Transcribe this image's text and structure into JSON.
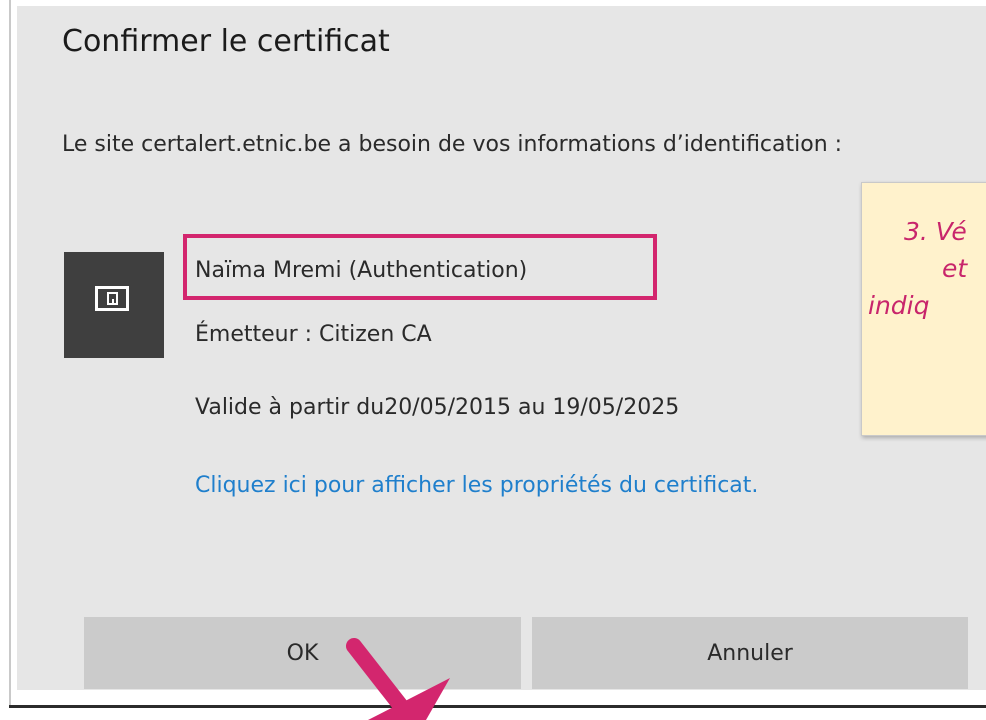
{
  "dialog": {
    "title": "Confirmer le certificat",
    "message": "Le site certalert.etnic.be a besoin de vos informations d’identification :",
    "certificate": {
      "icon": "certificate-card-icon",
      "name": "Naïma Mremi (Authentication)",
      "issuer": "Émetteur : Citizen CA",
      "validity": "Valide à partir du20/05/2015 au 19/05/2025"
    },
    "properties_link": "Cliquez ici pour afficher les propriétés du certificat.",
    "buttons": {
      "ok": "OK",
      "cancel": "Annuler"
    }
  },
  "annotation": {
    "callout_lines": [
      "3. Vé",
      "et",
      "indiq"
    ],
    "highlight_color": "#d3266e",
    "arrow_icon": "pointer-arrow-icon"
  },
  "colors": {
    "dialog_bg": "#e6e6e6",
    "button_bg": "#cbcbcb",
    "link": "#1f7fcc",
    "callout_bg": "#fff2cc",
    "callout_text": "#c8256b"
  }
}
